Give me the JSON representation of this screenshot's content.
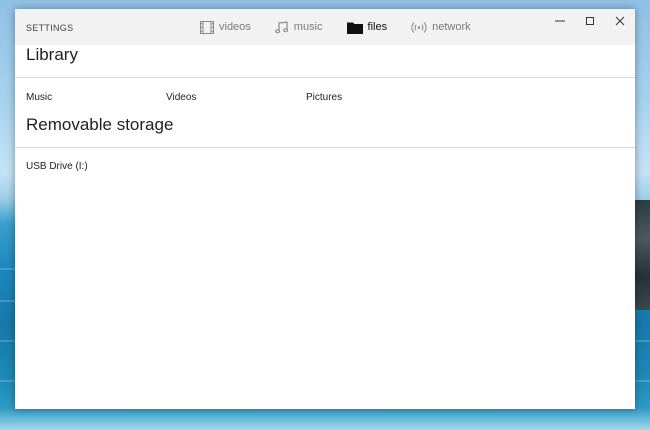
{
  "window": {
    "title": "SETTINGS"
  },
  "tabs": [
    {
      "label": "videos",
      "icon": "film-icon",
      "active": false
    },
    {
      "label": "music",
      "icon": "music-note-icon",
      "active": false
    },
    {
      "label": "files",
      "icon": "folder-icon",
      "active": true
    },
    {
      "label": "network",
      "icon": "network-signal-icon",
      "active": false
    }
  ],
  "window_controls": {
    "minimize": "minimize-icon",
    "maximize": "maximize-icon",
    "close": "close-icon"
  },
  "library": {
    "title": "Library",
    "items": [
      "Music",
      "Videos",
      "Pictures"
    ]
  },
  "removable": {
    "title": "Removable storage",
    "items": [
      "USB Drive (I:)"
    ]
  },
  "colors": {
    "titlebar_bg": "#f2f2f2",
    "active_tab": "#111111",
    "inactive_tab": "#7a7a7a",
    "divider": "#dadada"
  }
}
